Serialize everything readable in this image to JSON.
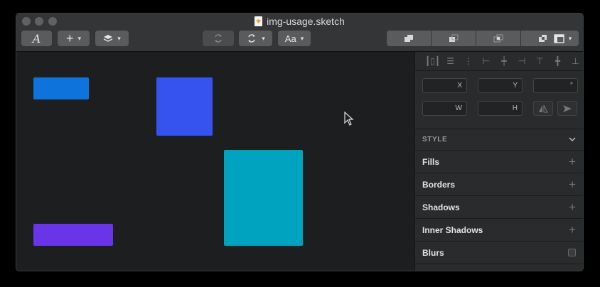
{
  "window": {
    "title": "img-usage.sketch"
  },
  "toolbar": {
    "text_tool_icon": "A",
    "insert_icon": "+",
    "layers_icon": "layers-icon",
    "font_label": "Aa",
    "chevron": "▾"
  },
  "canvas": {
    "shapes": [
      {
        "name": "blue-rectangle",
        "color": "#0e74dc"
      },
      {
        "name": "indigo-rectangle",
        "color": "#3653f0"
      },
      {
        "name": "teal-rectangle",
        "color": "#00a3bf"
      },
      {
        "name": "purple-rectangle",
        "color": "#6a34e8"
      }
    ]
  },
  "inspector": {
    "fields": {
      "x_label": "X",
      "y_label": "Y",
      "rotation_label": "°",
      "w_label": "W",
      "h_label": "H"
    },
    "style_header": "STYLE",
    "sections": [
      {
        "label": "Fills",
        "action": "+"
      },
      {
        "label": "Borders",
        "action": "+"
      },
      {
        "label": "Shadows",
        "action": "+"
      },
      {
        "label": "Inner Shadows",
        "action": "+"
      },
      {
        "label": "Blurs",
        "action": "checkbox"
      }
    ]
  }
}
